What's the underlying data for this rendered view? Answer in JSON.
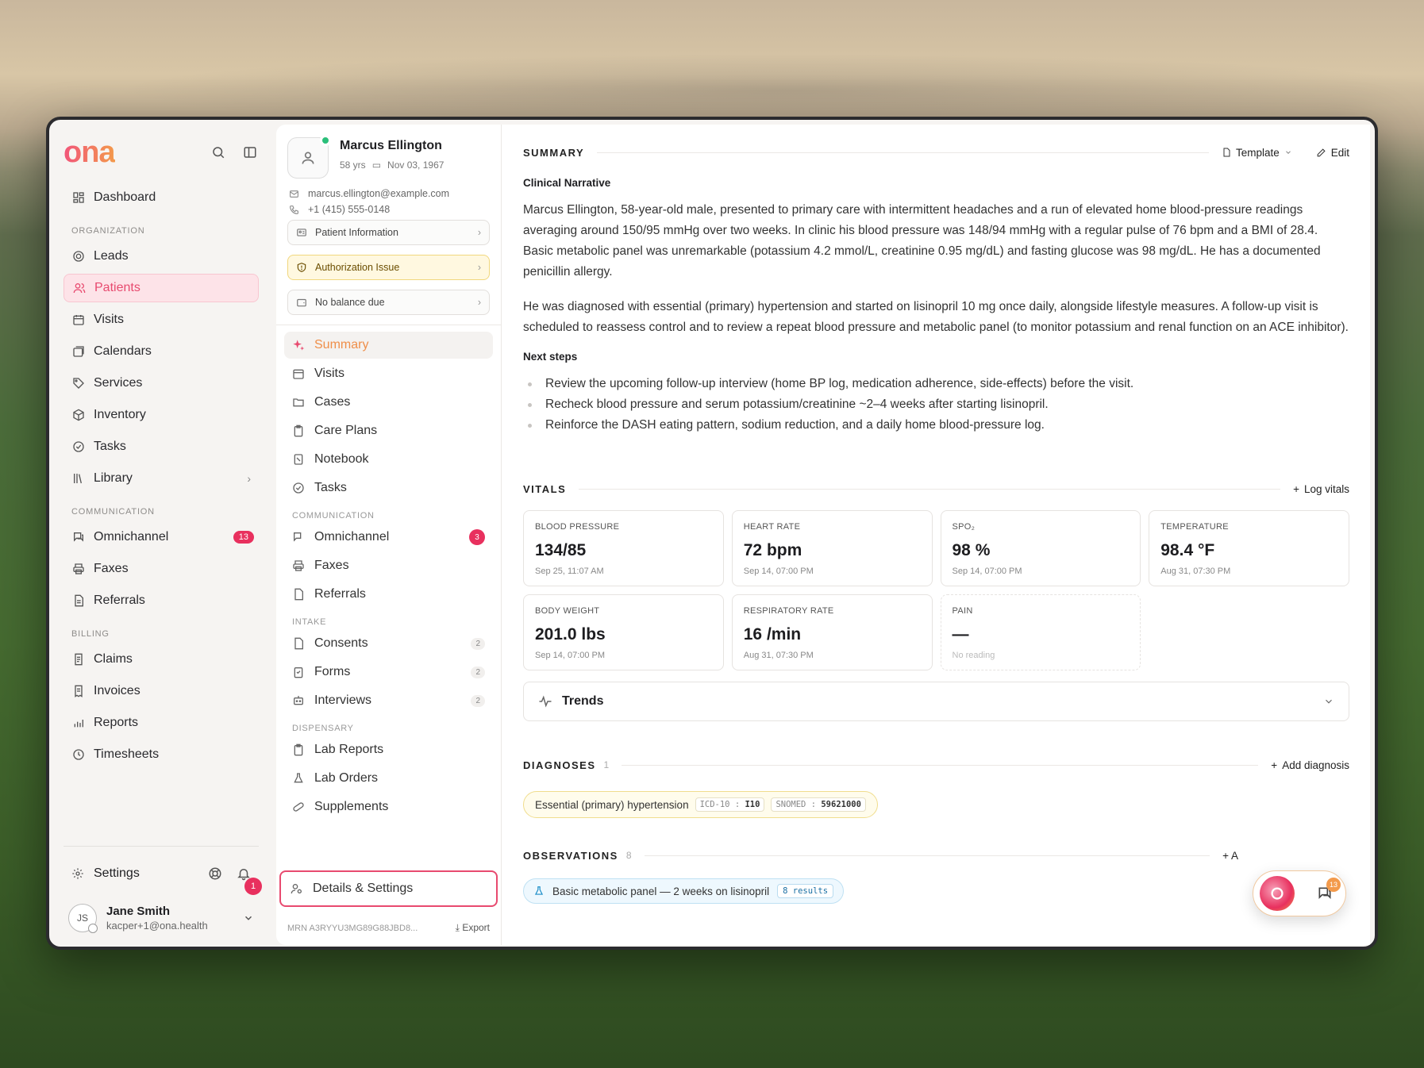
{
  "app": {
    "logo": "ona"
  },
  "sidebar": {
    "dashboard": "Dashboard",
    "org_label": "ORGANIZATION",
    "org_items": [
      {
        "label": "Leads",
        "icon": "target-icon"
      },
      {
        "label": "Patients",
        "icon": "users-icon",
        "active": true
      },
      {
        "label": "Visits",
        "icon": "calendar-grid-icon"
      },
      {
        "label": "Calendars",
        "icon": "calendar-stack-icon"
      },
      {
        "label": "Services",
        "icon": "tag-icon"
      },
      {
        "label": "Inventory",
        "icon": "box-icon"
      },
      {
        "label": "Tasks",
        "icon": "check-circle-icon"
      },
      {
        "label": "Library",
        "icon": "library-icon"
      }
    ],
    "comm_label": "COMMUNICATION",
    "comm_items": [
      {
        "label": "Omnichannel",
        "badge": "13"
      },
      {
        "label": "Faxes"
      },
      {
        "label": "Referrals"
      }
    ],
    "billing_label": "BILLING",
    "billing_items": [
      {
        "label": "Claims"
      },
      {
        "label": "Invoices"
      },
      {
        "label": "Reports"
      },
      {
        "label": "Timesheets"
      }
    ],
    "settings": "Settings",
    "notif_count": "1",
    "user": {
      "initials": "JS",
      "name": "Jane Smith",
      "email": "kacper+1@ona.health"
    }
  },
  "patient": {
    "name": "Marcus Ellington",
    "age": "58 yrs",
    "dob": "Nov 03, 1967",
    "email": "marcus.ellington@example.com",
    "phone": "+1 (415) 555-0148",
    "info_btn": "Patient Information",
    "auth_btn": "Authorization Issue",
    "balance_btn": "No balance due",
    "menu": {
      "summary": "Summary",
      "visits": "Visits",
      "cases": "Cases",
      "care_plans": "Care Plans",
      "notebook": "Notebook",
      "tasks": "Tasks",
      "comm_label": "COMMUNICATION",
      "omnichannel": "Omnichannel",
      "omni_count": "3",
      "faxes": "Faxes",
      "referrals": "Referrals",
      "intake_label": "INTAKE",
      "consents": "Consents",
      "consents_count": "2",
      "forms": "Forms",
      "forms_count": "2",
      "interviews": "Interviews",
      "interviews_count": "2",
      "dispensary_label": "DISPENSARY",
      "lab_reports": "Lab Reports",
      "lab_orders": "Lab Orders",
      "supplements": "Supplements"
    },
    "details_btn": "Details & Settings",
    "mrn": "MRN A3RYYU3MG89G88JBD8...",
    "export": "Export"
  },
  "summary": {
    "title": "SUMMARY",
    "template": "Template",
    "edit": "Edit",
    "narrative_title": "Clinical Narrative",
    "p1": "Marcus Ellington, 58-year-old male, presented to primary care with intermittent headaches and a run of elevated home blood-pressure readings averaging around 150/95 mmHg over two weeks. In clinic his blood pressure was 148/94 mmHg with a regular pulse of 76 bpm and a BMI of 28.4. Basic metabolic panel was unremarkable (potassium 4.2 mmol/L, creatinine 0.95 mg/dL) and fasting glucose was 98 mg/dL. He has a documented penicillin allergy.",
    "p2": "He was diagnosed with essential (primary) hypertension and started on lisinopril 10 mg once daily, alongside lifestyle measures. A follow-up visit is scheduled to reassess control and to review a repeat blood pressure and metabolic panel (to monitor potassium and renal function on an ACE inhibitor).",
    "next_title": "Next steps",
    "steps": [
      "Review the upcoming follow-up interview (home BP log, medication adherence, side-effects) before the visit.",
      "Recheck blood pressure and serum potassium/creatinine ~2–4 weeks after starting lisinopril.",
      "Reinforce the DASH eating pattern, sodium reduction, and a daily home blood-pressure log."
    ]
  },
  "vitals": {
    "title": "VITALS",
    "action": "Log vitals",
    "cards": [
      {
        "label": "BLOOD PRESSURE",
        "value": "134/85",
        "time": "Sep 25, 11:07 AM"
      },
      {
        "label": "HEART RATE",
        "value": "72 bpm",
        "time": "Sep 14, 07:00 PM"
      },
      {
        "label": "SPO₂",
        "value": "98 %",
        "time": "Sep 14, 07:00 PM"
      },
      {
        "label": "TEMPERATURE",
        "value": "98.4 °F",
        "time": "Aug 31, 07:30 PM"
      },
      {
        "label": "BODY WEIGHT",
        "value": "201.0 lbs",
        "time": "Sep 14, 07:00 PM"
      },
      {
        "label": "RESPIRATORY RATE",
        "value": "16 /min",
        "time": "Aug 31, 07:30 PM"
      },
      {
        "label": "PAIN",
        "value": "—",
        "time": "No reading"
      }
    ],
    "trends": "Trends"
  },
  "diagnoses": {
    "title": "DIAGNOSES",
    "count": "1",
    "action": "Add diagnosis",
    "name": "Essential (primary) hypertension",
    "icd_key": "ICD-10",
    "icd_val": "I10",
    "snomed_key": "SNOMED",
    "snomed_val": "59621000"
  },
  "observations": {
    "title": "OBSERVATIONS",
    "count": "8",
    "action": "+ A",
    "item": "Basic metabolic panel — 2 weeks on lisinopril",
    "results": "8 results"
  },
  "chat": {
    "badge": "13"
  }
}
